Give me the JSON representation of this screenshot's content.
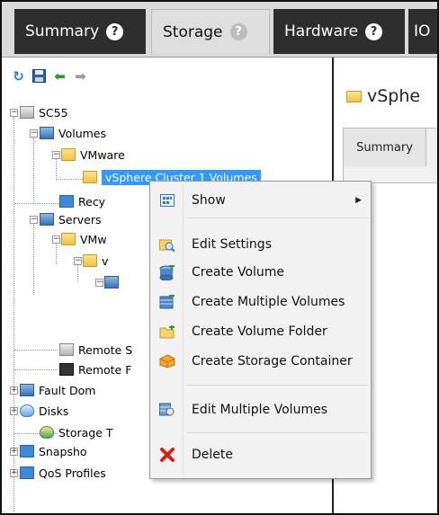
{
  "tabs": [
    {
      "label": "Summary",
      "help": "?"
    },
    {
      "label": "Storage",
      "help": "?"
    },
    {
      "label": "Hardware",
      "help": "?"
    },
    {
      "label": "IO",
      "help": ""
    }
  ],
  "tree": {
    "root": "SC55",
    "volumes": "Volumes",
    "vmware_folder": "VMware",
    "selected_item": "vSphere Cluster 1 Volumes",
    "recycle": "Recy",
    "servers": "Servers",
    "servers_vmware": "VMw",
    "servers_sub": "v",
    "remote1": "Remote S",
    "remote2": "Remote F",
    "fault_domains": "Fault Dom",
    "disks": "Disks",
    "storage_types": "Storage T",
    "snapshots": "Snapsho",
    "qos": "QoS Profiles"
  },
  "right_panel": {
    "title": "vSphe",
    "subtab": "Summary"
  },
  "menu": {
    "show": "Show",
    "edit_settings": "Edit Settings",
    "create_volume": "Create Volume",
    "create_multiple": "Create Multiple Volumes",
    "create_folder": "Create Volume Folder",
    "create_container": "Create Storage Container",
    "edit_multiple": "Edit Multiple Volumes",
    "delete": "Delete"
  },
  "colors": {
    "selection": "#3399ff",
    "dark_tab": "#2e2e2e",
    "delete_red": "#d42020"
  }
}
